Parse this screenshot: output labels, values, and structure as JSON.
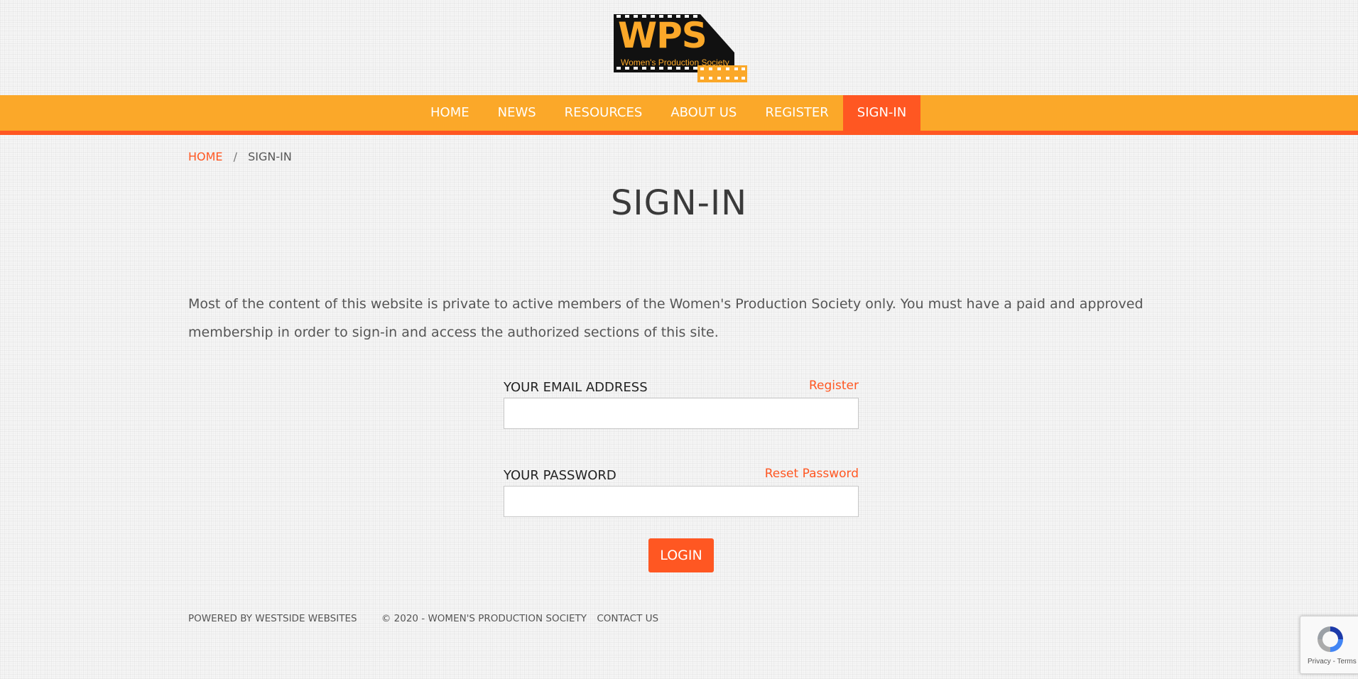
{
  "logo": {
    "text": "WPS",
    "tagline": "Women's Production Society"
  },
  "nav": {
    "items": [
      {
        "label": "HOME"
      },
      {
        "label": "NEWS"
      },
      {
        "label": "RESOURCES"
      },
      {
        "label": "ABOUT US"
      },
      {
        "label": "REGISTER"
      },
      {
        "label": "SIGN-IN",
        "active": true
      }
    ]
  },
  "breadcrumb": {
    "home": "HOME",
    "separator": "/",
    "current": "SIGN-IN"
  },
  "page": {
    "title": "SIGN-IN",
    "intro": "Most of the content of this website is private to active members of the Women's Production Society only.  You must have a paid and approved membership in order to sign-in and access the authorized sections of this site."
  },
  "form": {
    "email_label": "YOUR EMAIL ADDRESS",
    "register_link": "Register",
    "email_value": "",
    "password_label": "YOUR PASSWORD",
    "reset_link": "Reset Password",
    "password_value": "",
    "login_button": "LOGIN"
  },
  "footer": {
    "powered": "POWERED BY WESTSIDE WEBSITES",
    "copyright": "© 2020 - WOMEN'S PRODUCTION SOCIETY",
    "contact": "CONTACT US"
  },
  "recaptcha": {
    "privacy": "Privacy",
    "separator": "-",
    "terms": "Terms",
    "icon": "recaptcha-icon"
  },
  "colors": {
    "nav": "#fba829",
    "accent": "#ff5722",
    "text": "#444444"
  }
}
